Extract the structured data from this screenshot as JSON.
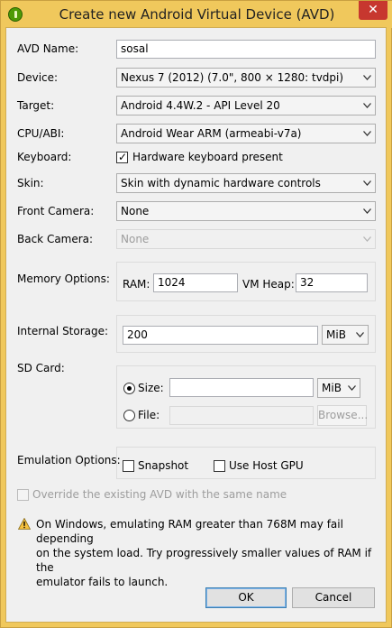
{
  "window": {
    "title": "Create new Android Virtual Device (AVD)",
    "close_glyph": "✕"
  },
  "avd_name": {
    "label": "AVD Name:",
    "value": "sosal"
  },
  "device": {
    "label": "Device:",
    "value": "Nexus 7 (2012) (7.0\", 800 × 1280: tvdpi)"
  },
  "target": {
    "label": "Target:",
    "value": "Android 4.4W.2 - API Level 20"
  },
  "cpu_abi": {
    "label": "CPU/ABI:",
    "value": "Android Wear ARM (armeabi-v7a)"
  },
  "keyboard": {
    "label": "Keyboard:",
    "checkbox_label": "Hardware keyboard present",
    "checked": true
  },
  "skin": {
    "label": "Skin:",
    "value": "Skin with dynamic hardware controls"
  },
  "front_camera": {
    "label": "Front Camera:",
    "value": "None"
  },
  "back_camera": {
    "label": "Back Camera:",
    "value": "None",
    "enabled": false
  },
  "memory": {
    "label": "Memory Options:",
    "ram_label": "RAM:",
    "ram_value": "1024",
    "vm_heap_label": "VM Heap:",
    "vm_heap_value": "32"
  },
  "internal_storage": {
    "label": "Internal Storage:",
    "value": "200",
    "unit": "MiB"
  },
  "sd_card": {
    "label": "SD Card:",
    "size_label": "Size:",
    "size_value": "",
    "size_unit": "MiB",
    "size_selected": true,
    "file_label": "File:",
    "file_value": "",
    "browse_label": "Browse..."
  },
  "emulation": {
    "label": "Emulation Options:",
    "snapshot_label": "Snapshot",
    "snapshot_checked": false,
    "host_gpu_label": "Use Host GPU",
    "host_gpu_checked": false
  },
  "override": {
    "label": "Override the existing AVD with the same name",
    "checked": false,
    "enabled": false
  },
  "warning": {
    "line1": "On Windows, emulating RAM greater than 768M may fail depending",
    "line2": "on the system load. Try progressively smaller values of RAM if the",
    "line3": "emulator fails to launch."
  },
  "buttons": {
    "ok": "OK",
    "cancel": "Cancel"
  },
  "colors": {
    "title_bar": "#f0c85c",
    "close_button": "#c7372f",
    "dialog_bg": "#f0f0f0",
    "default_button_border": "#3c7fb1"
  }
}
